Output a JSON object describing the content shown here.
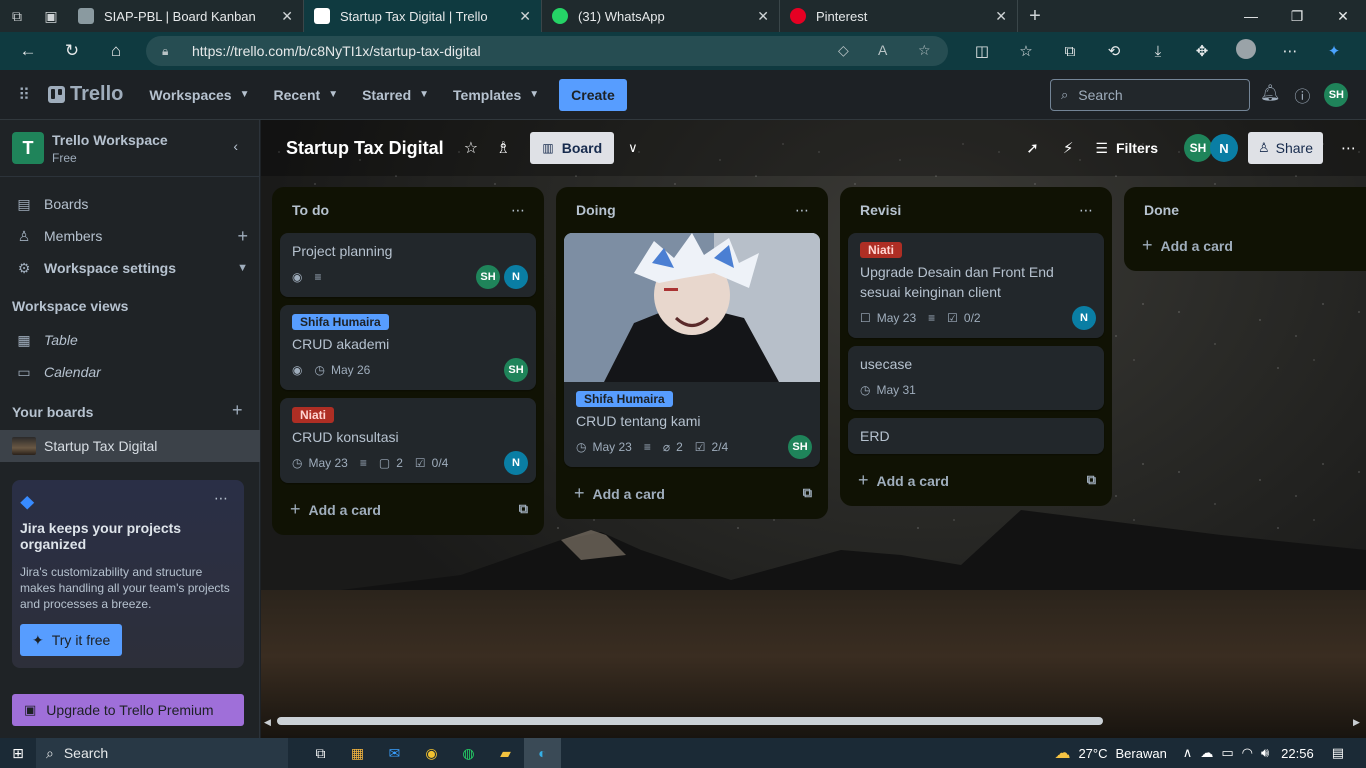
{
  "browser": {
    "tabs": [
      {
        "title": "SIAP-PBL | Board Kanban",
        "active": false
      },
      {
        "title": "Startup Tax Digital | Trello",
        "active": true
      },
      {
        "title": "(31) WhatsApp",
        "active": false
      },
      {
        "title": "Pinterest",
        "active": false
      }
    ],
    "url": "https://trello.com/b/c8NyTI1x/startup-tax-digital"
  },
  "header": {
    "logo": "Trello",
    "menus": [
      "Workspaces",
      "Recent",
      "Starred",
      "Templates"
    ],
    "create_label": "Create",
    "search_placeholder": "Search",
    "user_initials": "SH"
  },
  "sidebar": {
    "workspace_name": "Trello Workspace",
    "workspace_plan": "Free",
    "workspace_initial": "T",
    "items": {
      "boards": "Boards",
      "members": "Members",
      "settings": "Workspace settings"
    },
    "views_title": "Workspace views",
    "views": [
      "Table",
      "Calendar"
    ],
    "your_boards_title": "Your boards",
    "current_board": "Startup Tax Digital",
    "promo": {
      "title": "Jira keeps your projects organized",
      "desc": "Jira's customizability and structure makes handling all your team's projects and processes a breeze.",
      "button": "Try it free"
    },
    "upgrade_label": "Upgrade to Trello Premium"
  },
  "board": {
    "title": "Startup Tax Digital",
    "view_label": "Board",
    "filters_label": "Filters",
    "share_label": "Share",
    "members": [
      "SH",
      "N"
    ],
    "add_card_label": "Add a card",
    "lists": [
      {
        "title": "To do",
        "cards": [
          {
            "title": "Project planning",
            "members": [
              "SH",
              "N"
            ]
          },
          {
            "label": "Shifa Humaira",
            "title": "CRUD akademi",
            "date": "May 26",
            "members": [
              "SH"
            ]
          },
          {
            "label": "Niati",
            "title": "CRUD konsultasi",
            "date": "May 23",
            "comments": "2",
            "checklist": "0/4",
            "members": [
              "N"
            ]
          }
        ]
      },
      {
        "title": "Doing",
        "cards": [
          {
            "label": "Shifa Humaira",
            "title": "CRUD tentang kami",
            "date": "May 23",
            "attachments": "2",
            "checklist": "2/4",
            "members": [
              "SH"
            ]
          }
        ]
      },
      {
        "title": "Revisi",
        "cards": [
          {
            "label": "Niati",
            "title": "Upgrade Desain dan Front End sesuai keinginan client",
            "date": "May 23",
            "checklist": "0/2",
            "members": [
              "N"
            ]
          },
          {
            "title": "usecase",
            "date": "May 31"
          },
          {
            "title": "ERD"
          }
        ]
      },
      {
        "title": "Done",
        "cards": []
      }
    ]
  },
  "taskbar": {
    "search": "Search",
    "weather": "27°C",
    "weather_text": "Berawan",
    "time": "22:56"
  },
  "colors": {
    "accent": "#579dff",
    "label_blue": "#579dff",
    "label_red": "#ae2e24",
    "member_sh": "#1f845a",
    "member_n": "#0a7ea4",
    "premium": "#9f6fd9"
  }
}
